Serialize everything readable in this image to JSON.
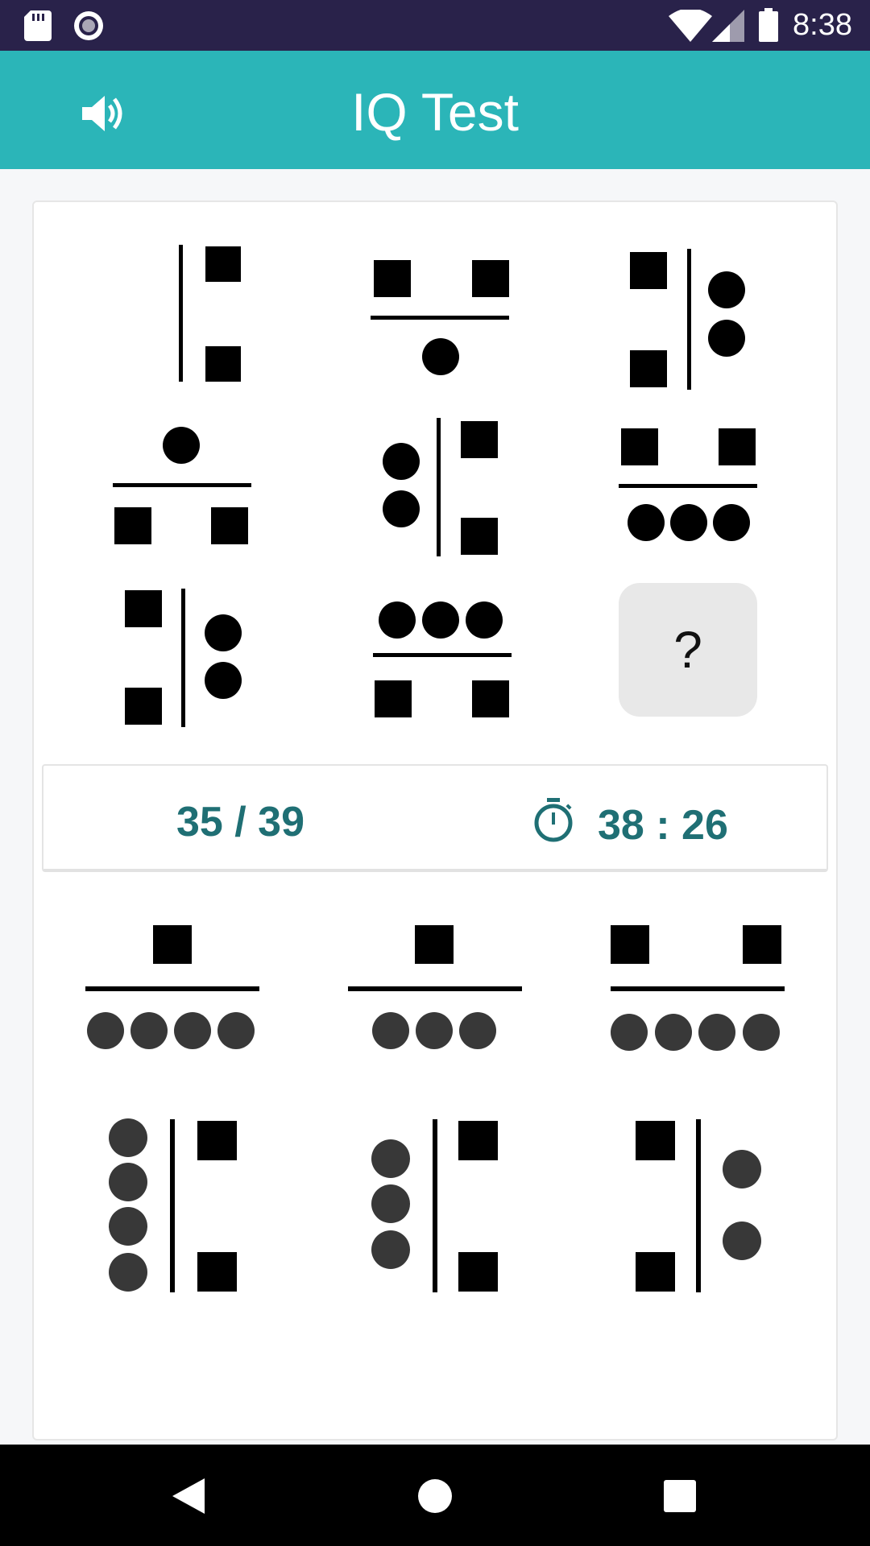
{
  "status_bar": {
    "time": "8:38",
    "icons": [
      "sd-card-icon",
      "record-icon",
      "wifi-icon",
      "signal-icon",
      "battery-icon"
    ]
  },
  "app_bar": {
    "title": "IQ Test",
    "sound_icon": "volume-icon"
  },
  "puzzle": {
    "missing_label": "?",
    "cells": [
      "bar-left squares-right-2",
      "squares-top-2 circle-bottom-1",
      "squares-left-2 circles-right-2",
      "circle-top-1 squares-bottom-2",
      "circles-left-2 squares-right-2",
      "squares-top-2 circles-bottom-3",
      "squares-left-2 circles-right-2",
      "circles-top-3 squares-bottom-2",
      "missing"
    ]
  },
  "info": {
    "progress": "35 / 39",
    "timer": "38 : 26",
    "timer_icon": "stopwatch-icon"
  },
  "answers": {
    "options": [
      "squares-top-1 circles-bottom-4",
      "squares-top-1 circles-bottom-3",
      "squares-top-2 circles-bottom-4",
      "circles-left-4 squares-right-2",
      "circles-left-3 squares-right-2",
      "squares-left-2 circles-right-2"
    ]
  },
  "colors": {
    "status_bar": "#29224a",
    "app_bar": "#2bb5b8",
    "accent_text": "#1f6f74",
    "answer_circle": "#383838"
  },
  "nav_bar": {
    "icons": [
      "back-icon",
      "home-icon",
      "recents-icon"
    ]
  }
}
